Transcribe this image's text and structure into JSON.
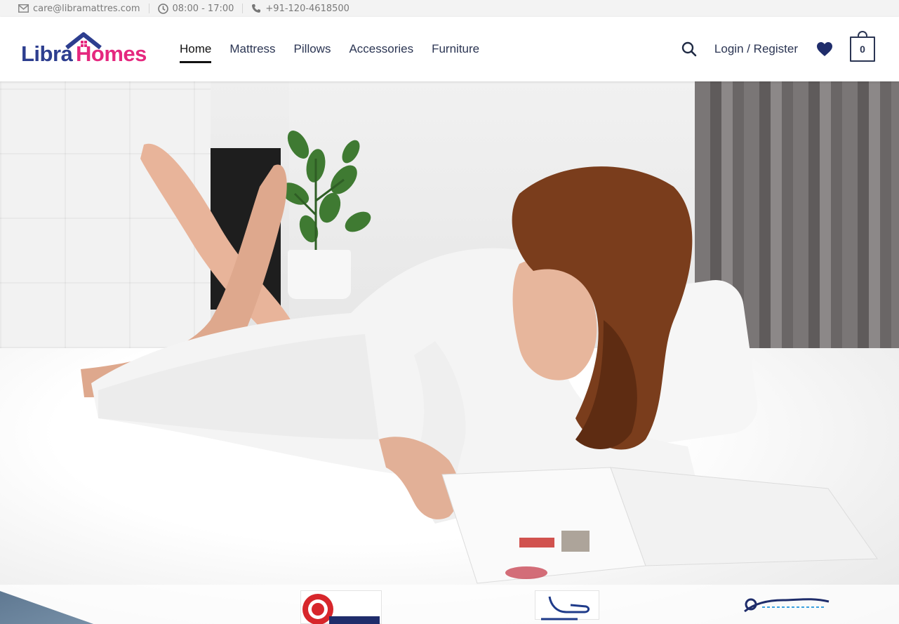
{
  "topbar": {
    "email": "care@libramattres.com",
    "hours": "08:00 - 17:00",
    "phone": "+91-120-4618500"
  },
  "header": {
    "logo": {
      "part1": "Libra",
      "part2": "Homes"
    },
    "nav": [
      {
        "label": "Home",
        "active": true
      },
      {
        "label": "Mattress",
        "active": false
      },
      {
        "label": "Pillows",
        "active": false
      },
      {
        "label": "Accessories",
        "active": false
      },
      {
        "label": "Furniture",
        "active": false
      }
    ],
    "login_label": "Login / Register",
    "cart_count": "0",
    "icons": [
      "mail-icon",
      "clock-icon",
      "phone-icon",
      "search-icon",
      "heart-icon",
      "cart-icon"
    ]
  },
  "hero": {
    "image": "woman-reading-magazine-on-bed"
  },
  "colors": {
    "brand_blue": "#2d3e8f",
    "brand_pink": "#e5287f",
    "nav_text": "#2b3553",
    "topbar_bg": "#f3f3f3"
  }
}
